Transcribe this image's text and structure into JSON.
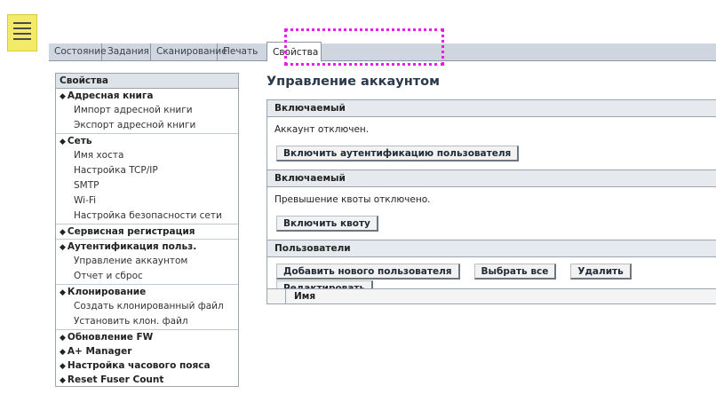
{
  "app": {
    "doc_icon": "document-icon"
  },
  "tabs": [
    {
      "label": "Состояние",
      "active": false
    },
    {
      "label": "Задания",
      "active": false
    },
    {
      "label": "Сканирование",
      "active": false
    },
    {
      "label": "Печать",
      "active": false
    },
    {
      "label": "Свойства",
      "active": true
    }
  ],
  "sidebar": {
    "header": "Свойства",
    "sections": [
      {
        "title": "Адресная книга",
        "items": [
          "Импорт адресной книги",
          "Экспорт адресной книги"
        ]
      },
      {
        "title": "Сеть",
        "items": [
          "Имя хоста",
          "Настройка TCP/IP",
          "SMTP",
          "Wi-Fi",
          "Настройка безопасности сети"
        ]
      },
      {
        "title": "Сервисная регистрация",
        "items": []
      },
      {
        "title": "Аутентификация польз.",
        "items": [
          "Управление аккаунтом",
          "Отчет и сброс"
        ]
      },
      {
        "title": "Клонирование",
        "items": [
          "Создать клонированный файл",
          "Установить клон. файл"
        ]
      },
      {
        "title": "Обновление FW",
        "items": []
      },
      {
        "title": "A+ Manager",
        "items": []
      },
      {
        "title": "Настройка часового пояса",
        "items": []
      },
      {
        "title": "Reset Fuser Count",
        "items": []
      }
    ]
  },
  "main": {
    "title": "Управление аккаунтом",
    "account": {
      "header": "Включаемый",
      "status": "Аккаунт отключен.",
      "button": "Включить аутентификацию пользователя"
    },
    "quota": {
      "header": "Включаемый",
      "status": "Превышение квоты отключено.",
      "button": "Включить квоту"
    },
    "users": {
      "header": "Пользователи",
      "buttons": [
        "Добавить нового пользователя",
        "Выбрать все",
        "Удалить",
        "Редактировать"
      ],
      "column_name": "Имя"
    }
  },
  "colors": {
    "highlight": "#e81ee8",
    "doc_icon": "#f4ea6a"
  }
}
